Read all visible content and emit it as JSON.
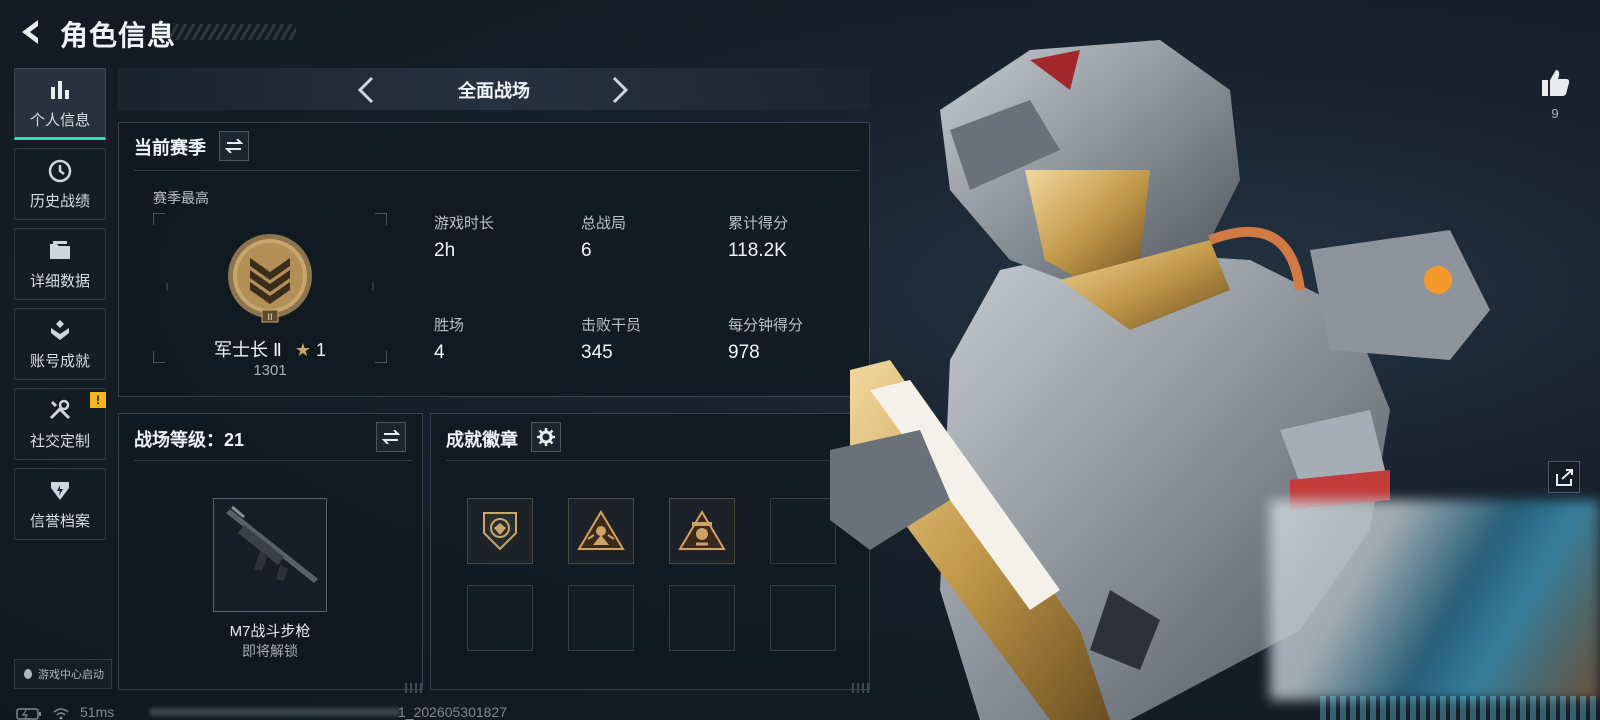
{
  "header": {
    "title": "角色信息"
  },
  "sidebar": {
    "items": [
      {
        "label": "个人信息",
        "active": true
      },
      {
        "label": "历史战绩"
      },
      {
        "label": "详细数据"
      },
      {
        "label": "账号成就"
      },
      {
        "label": "社交定制",
        "badge": "!"
      },
      {
        "label": "信誉档案"
      }
    ],
    "game_center": "游戏中心启动"
  },
  "mode_selector": {
    "current": "全面战场"
  },
  "season": {
    "title": "当前赛季",
    "subtitle": "赛季最高",
    "rank_name": "军士长 Ⅱ",
    "rank_stars": "1",
    "rank_score": "1301",
    "stats": [
      {
        "label": "游戏时长",
        "value": "2h"
      },
      {
        "label": "总战局",
        "value": "6"
      },
      {
        "label": "累计得分",
        "value": "118.2K"
      },
      {
        "label": "胜场",
        "value": "4"
      },
      {
        "label": "击败干员",
        "value": "345"
      },
      {
        "label": "每分钟得分",
        "value": "978"
      }
    ]
  },
  "battlefield_level": {
    "title": "战场等级：21",
    "weapon_name": "M7战斗步枪",
    "weapon_status": "即将解锁"
  },
  "badges": {
    "title": "成就徽章",
    "slots": [
      {
        "icon": "shield-badge-icon",
        "filled": true
      },
      {
        "icon": "triangle-operator-badge-icon",
        "filled": true
      },
      {
        "icon": "triangle-skull-badge-icon",
        "filled": true
      },
      {
        "filled": false
      },
      {
        "filled": false
      },
      {
        "filled": false
      },
      {
        "filled": false
      },
      {
        "filled": false
      }
    ]
  },
  "social": {
    "like_count": "9"
  },
  "footer": {
    "ping": "51ms",
    "build_id": "1_202605301827"
  },
  "colors": {
    "accent": "#2fe0b3",
    "warning": "#f3b61c",
    "gold": "#c9a66b"
  }
}
